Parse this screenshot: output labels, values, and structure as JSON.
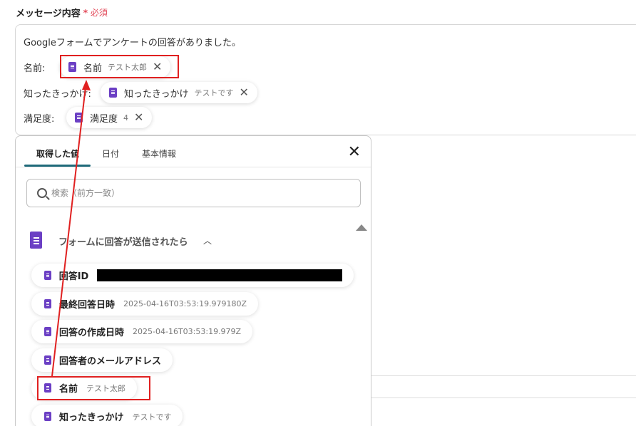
{
  "section": {
    "label": "メッセージ内容",
    "required_mark": "*",
    "required_label": "必須"
  },
  "message": {
    "line1": "Googleフォームでアンケートの回答がありました。",
    "name_label": "名前:",
    "know_label": "知ったきっかけ:",
    "satisfaction_label": "満足度:"
  },
  "chips": [
    {
      "name": "名前",
      "sub": "テスト太郎"
    },
    {
      "name": "知ったきっかけ",
      "sub": "テストです"
    },
    {
      "name": "満足度",
      "sub": "4"
    }
  ],
  "panel": {
    "tabs": [
      "取得した値",
      "日付",
      "基本情報"
    ],
    "search_placeholder": "検索（前方一致）",
    "group_title": "フォームに回答が送信されたら",
    "items": [
      {
        "name": "回答ID",
        "sub": ""
      },
      {
        "name": "最終回答日時",
        "sub": "2025-04-16T03:53:19.979180Z"
      },
      {
        "name": "回答の作成日時",
        "sub": "2025-04-16T03:53:19.979Z"
      },
      {
        "name": "回答者のメールアドレス",
        "sub": ""
      },
      {
        "name": "名前",
        "sub": "テスト太郎"
      },
      {
        "name": "知ったきっかけ",
        "sub": "テストです"
      }
    ]
  },
  "icons": {
    "close": "close-icon",
    "search": "search-icon",
    "form": "form-icon",
    "caret": "chevron-up-icon"
  },
  "colors": {
    "accent": "#1f6a7a",
    "form_purple": "#6b3fc4",
    "required_red": "#e24a5a",
    "highlight_red": "#e02020"
  }
}
